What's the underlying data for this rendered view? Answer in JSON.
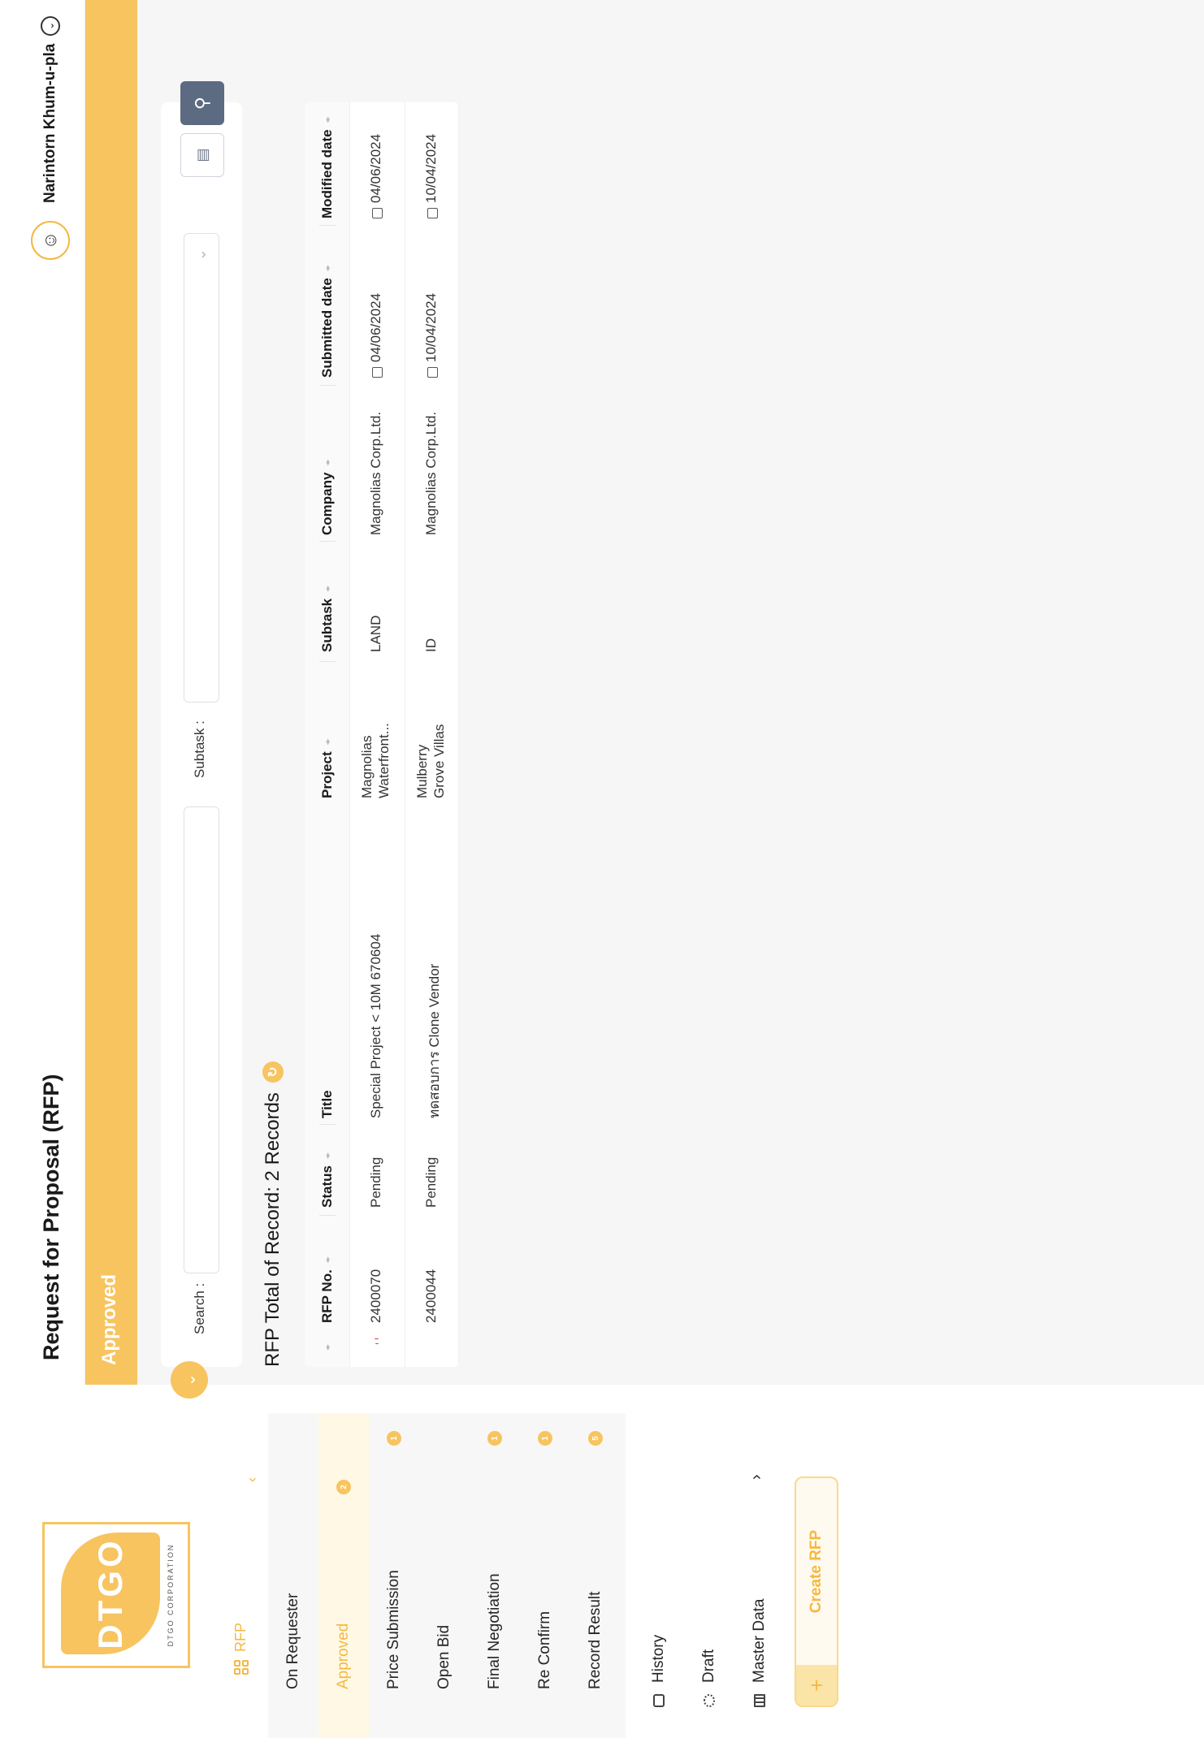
{
  "brand": {
    "logo_text": "DTGO",
    "logo_sub": "DTGO CORPORATION"
  },
  "sidebar": {
    "section_label": "RFP",
    "sub_items": [
      {
        "label": "On Requester",
        "badge": ""
      },
      {
        "label": "Approved",
        "badge": "2"
      },
      {
        "label": "Price Submission",
        "badge": "1"
      },
      {
        "label": "Open Bid",
        "badge": ""
      },
      {
        "label": "Final Negotiation",
        "badge": "1"
      },
      {
        "label": "Re Confirm",
        "badge": "1"
      },
      {
        "label": "Record Result",
        "badge": "5"
      }
    ],
    "nav_items": [
      {
        "label": "History",
        "icon": "history-icon"
      },
      {
        "label": "Draft",
        "icon": "draft-icon"
      },
      {
        "label": "Master Data",
        "icon": "table-icon"
      }
    ],
    "create_label": "Create RFP",
    "accent": "#f7c460"
  },
  "header": {
    "title": "Request for Proposal (RFP)",
    "user_name": "Narintorn Khum-u-pla"
  },
  "banner": {
    "label": "Approved"
  },
  "filters": {
    "search_label": "Search :",
    "search_value": "",
    "subtask_label": "Subtask :",
    "subtask_value": ""
  },
  "records": {
    "label": "RFP Total of Record: 2 Records"
  },
  "table": {
    "columns": [
      "RFP No.",
      "Status",
      "Title",
      "Project",
      "Subtask",
      "Company",
      "Submitted date",
      "Modified date"
    ],
    "rows": [
      {
        "flag": true,
        "rfp_no": "2400070",
        "status": "Pending",
        "title": "Special Project < 10M 670604",
        "project_line1": "Magnolias",
        "project_line2": "Waterfront...",
        "subtask": "LAND",
        "company": "Magnolias Corp.Ltd.",
        "submitted": "04/06/2024",
        "modified": "04/06/2024"
      },
      {
        "flag": false,
        "rfp_no": "2400044",
        "status": "Pending",
        "title": "ทดสอบการ Clone Vendor",
        "project_line1": "Mulberry",
        "project_line2": "Grove Villas",
        "subtask": "ID",
        "company": "Magnolias Corp.Ltd.",
        "submitted": "10/04/2024",
        "modified": "10/04/2024"
      }
    ]
  }
}
